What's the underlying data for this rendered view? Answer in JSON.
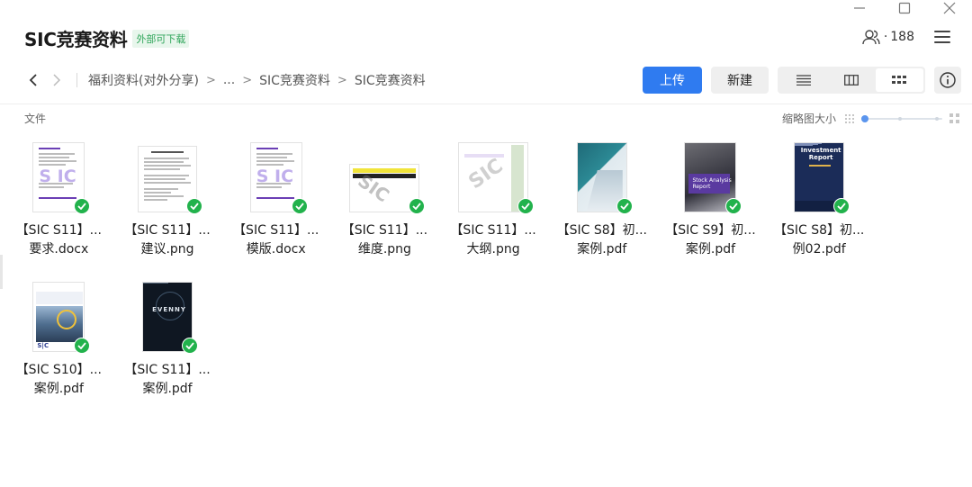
{
  "window": {
    "minimize_icon": "minimize-icon",
    "maximize_icon": "maximize-icon",
    "close_icon": "close-icon"
  },
  "header": {
    "title": "SIC竞赛资料",
    "badge": "外部可下载",
    "members_count": "188",
    "members_sep": "·"
  },
  "nav": {
    "breadcrumbs": [
      "福利资料(对外分享)",
      "...",
      "SIC竞赛资料",
      "SIC竞赛资料"
    ]
  },
  "toolbar": {
    "upload_label": "上传",
    "new_label": "新建",
    "active_view": "grid"
  },
  "list_header": {
    "file_label": "文件",
    "thumb_size_label": "缩略图大小",
    "thumb_size_level": 0
  },
  "colors": {
    "accent": "#2f7bf0",
    "success": "#22b24c",
    "badge_text": "#2fa55a"
  },
  "files": [
    {
      "line1": "【SIC S11】...",
      "line2": "要求.docx",
      "thumb": "doc-purple"
    },
    {
      "line1": "【SIC S11】...",
      "line2": "建议.png",
      "thumb": "doc-plain"
    },
    {
      "line1": "【SIC S11】...",
      "line2": "模版.docx",
      "thumb": "doc-purple"
    },
    {
      "line1": "【SIC S11】...",
      "line2": "维度.png",
      "thumb": "table-wide"
    },
    {
      "line1": "【SIC S11】...",
      "line2": "大纲.png",
      "thumb": "doc-outline"
    },
    {
      "line1": "【SIC S8】初...",
      "line2": "案例.pdf",
      "thumb": "cover-teal"
    },
    {
      "line1": "【SIC S9】初...",
      "line2": "案例.pdf",
      "thumb": "cover-purple"
    },
    {
      "line1": "【SIC S8】初...",
      "line2": "例02.pdf",
      "thumb": "cover-navy"
    },
    {
      "line1": "【SIC S10】...",
      "line2": "案例.pdf",
      "thumb": "cover-city"
    },
    {
      "line1": "【SIC S11】...",
      "line2": "案例.pdf",
      "thumb": "cover-dark"
    }
  ]
}
